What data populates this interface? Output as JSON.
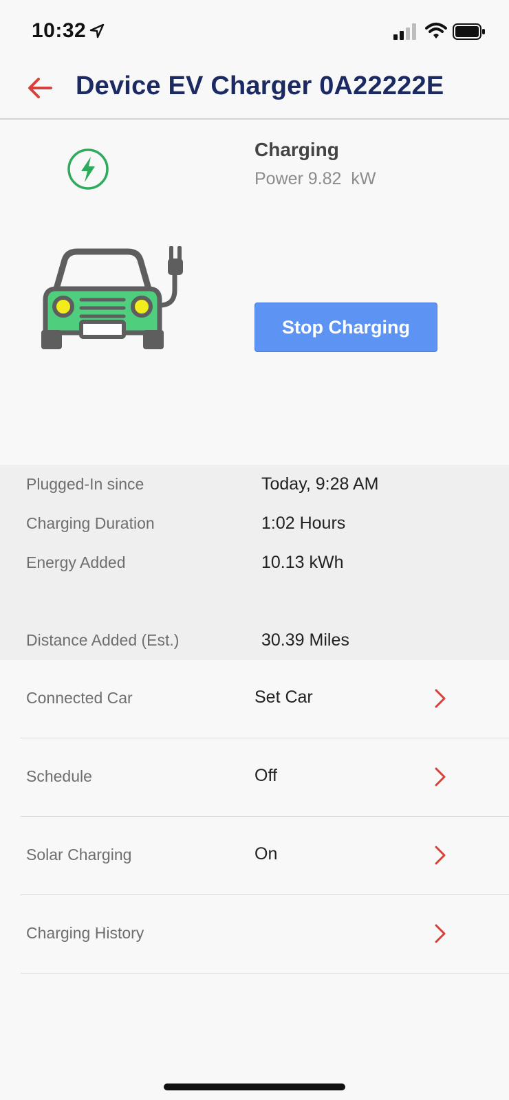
{
  "status_bar": {
    "time": "10:32",
    "icons": [
      "location-arrow-icon",
      "cellular-signal-icon",
      "wifi-icon",
      "battery-icon"
    ]
  },
  "header": {
    "title": "Device EV Charger 0A22222E",
    "back_icon": "back-arrow-icon"
  },
  "charger": {
    "status": "Charging",
    "power": "Power 9.82  kW",
    "status_icon": "lightning-bolt-icon",
    "illustration": "electric-car-with-plug-icon",
    "stop_button_label": "Stop Charging"
  },
  "stats": [
    {
      "label": "Plugged-In since",
      "value": "Today, 9:28 AM"
    },
    {
      "label": "Charging Duration",
      "value": "1:02 Hours"
    },
    {
      "label": "Energy Added",
      "value": "10.13 kWh"
    },
    {
      "label": "Distance Added (Est.)",
      "value": "30.39 Miles"
    }
  ],
  "settings": [
    {
      "label": "Connected Car",
      "value": "Set Car"
    },
    {
      "label": "Schedule",
      "value": "Off"
    },
    {
      "label": "Solar Charging",
      "value": "On"
    },
    {
      "label": "Charging History",
      "value": ""
    }
  ],
  "colors": {
    "accent_red": "#d9403a",
    "title_navy": "#1b2a63",
    "button_blue": "#5d93f2",
    "charging_green": "#2eaa5c",
    "car_green": "#4fcf7d",
    "headlight_yellow": "#f2ec1c"
  }
}
